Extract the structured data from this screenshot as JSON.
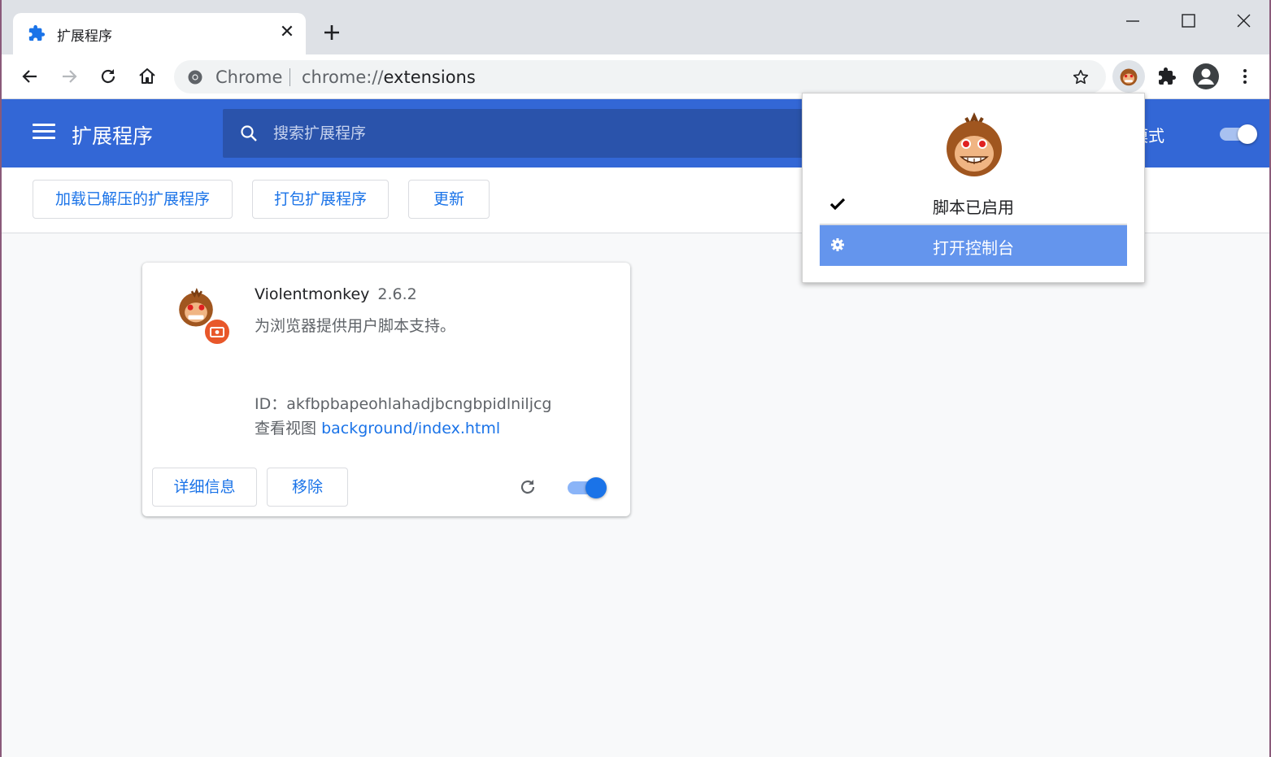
{
  "browser": {
    "tab": {
      "title": "扩展程序",
      "icon": "puzzle-icon",
      "close_glyph": "✕"
    },
    "new_tab_icon": "plus-icon",
    "window_controls": [
      "minimize-icon",
      "maximize-icon",
      "close-icon"
    ]
  },
  "toolbar": {
    "omnibox": {
      "security_chip": "Chrome",
      "url_scheme": "chrome://",
      "url_path": "extensions"
    },
    "icons": [
      "back-arrow-icon",
      "forward-arrow-icon",
      "reload-icon",
      "home-icon",
      "bookmark-star-icon",
      "violentmonkey-extension-icon",
      "extensions-puzzle-icon",
      "profile-avatar-icon",
      "more-vert-icon"
    ]
  },
  "extensions_page": {
    "header": {
      "title": "扩展程序",
      "search_placeholder": "搜索扩展程序",
      "dev_mode_label": "开发者模式",
      "dev_mode_on": true
    },
    "actions": {
      "load_unpacked": "加载已解压的扩展程序",
      "pack": "打包扩展程序",
      "update": "更新"
    },
    "extension": {
      "name": "Violentmonkey",
      "version": "2.6.2",
      "description": "为浏览器提供用户脚本支持。",
      "id_label": "ID：",
      "id_value": "akfbpbapeohlahadjbcngbpidlniljcg",
      "views_label": "查看视图",
      "views_link": "background/index.html",
      "details_button": "详细信息",
      "remove_button": "移除",
      "enabled": true
    }
  },
  "popup": {
    "items": [
      {
        "label": "脚本已启用",
        "icon": "check-icon"
      },
      {
        "label": "打开控制台",
        "icon": "gear-icon",
        "highlighted": true
      }
    ]
  },
  "colors": {
    "header_blue": "#3367d6",
    "search_blue": "#2a53ab",
    "link_blue": "#1a73e8",
    "popup_highlight": "#6495ed"
  }
}
